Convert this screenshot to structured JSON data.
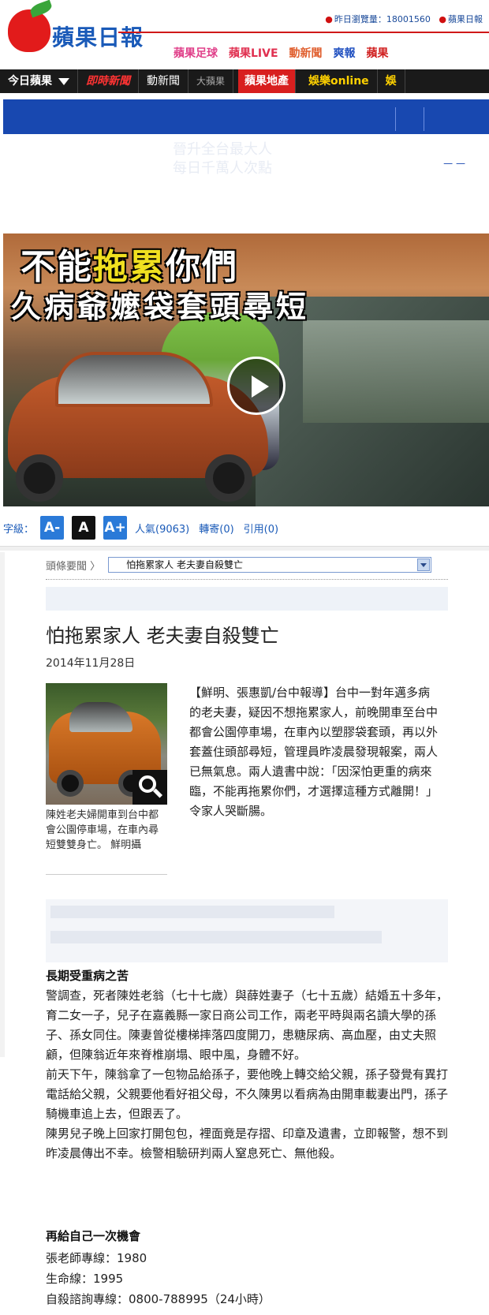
{
  "header": {
    "logo_text": "蘋果日報",
    "visitor_label": "昨日瀏覽量：18001560",
    "right_link": "蘋果日報",
    "sublinks": [
      "蘋果足球",
      "蘋果LIVE",
      "動新聞",
      "爽報",
      "蘋果"
    ]
  },
  "nav": {
    "home": "今日蘋果",
    "items": [
      "即時新聞",
      "動新聞",
      "大蘋果",
      "蘋果地產",
      "娛樂online",
      "娛"
    ]
  },
  "ad": {
    "ghost_line1": "晉升全台最大人",
    "ghost_line2": "每日千萬人次點"
  },
  "video": {
    "caption_prefix": "不能",
    "caption_hl1": "拖",
    "caption_hl2": "累",
    "caption_suffix": "你們",
    "caption_line2": "久病爺嬤袋套頭尋短"
  },
  "toolbar": {
    "font_label": "字級：",
    "font_small": "A-",
    "font_normal": "A",
    "font_large": "A+",
    "popularity": "人氣(9063)",
    "forward": "轉寄(0)",
    "cite": "引用(0)"
  },
  "crumb": {
    "label": "頭條要聞 〉",
    "selected": "怕拖累家人 老夫妻自殺雙亡"
  },
  "article": {
    "title": "怕拖累家人 老夫妻自殺雙亡",
    "date": "2014年11月28日",
    "photo_caption": "陳姓老夫婦開車到台中都會公園停車場，在車內尋短雙雙身亡。 鮮明攝",
    "lead": "【鮮明、張惠凱/台中報導】台中一對年邁多病的老夫妻，疑因不想拖累家人，前晚開車至台中都會公園停車場，在車內以塑膠袋套頭，再以外套蓋住頭部尋短，管理員昨凌晨發現報案，兩人已無氣息。兩人遺書中說：「因深怕更重的病來臨，不能再拖累你們，才選擇這種方式離開！」令家人哭斷腸。",
    "subhead1": "長期受重病之苦",
    "paragraphs": [
      "警調查，死者陳姓老翁（七十七歲）與薛姓妻子（七十五歲）結婚五十多年，育二女一子，兒子在嘉義縣一家日商公司工作，兩老平時與兩名讀大學的孫子、孫女同住。陳妻曾從樓梯摔落四度開刀，患糖尿病、高血壓，由丈夫照顧，但陳翁近年來脊椎崩塌、眼中風，身體不好。",
      "前天下午，陳翁拿了一包物品給孫子，要他晚上轉交給父親，孫子發覺有異打電話給父親，父親要他看好祖父母，不久陳男以看病為由開車載妻出門，孫子騎機車追上去，但跟丟了。",
      "陳男兒子晚上回家打開包包，裡面竟是存摺、印章及遺書，立即報警，想不到昨凌晨傳出不幸。檢警相驗研判兩人窒息死亡、無他殺。"
    ],
    "subhead2": "再給自己一次機會",
    "hotlines": [
      "張老師專線：1980",
      "生命線：1995",
      "自殺諮詢專線：0800-788995（24小時）"
    ]
  }
}
